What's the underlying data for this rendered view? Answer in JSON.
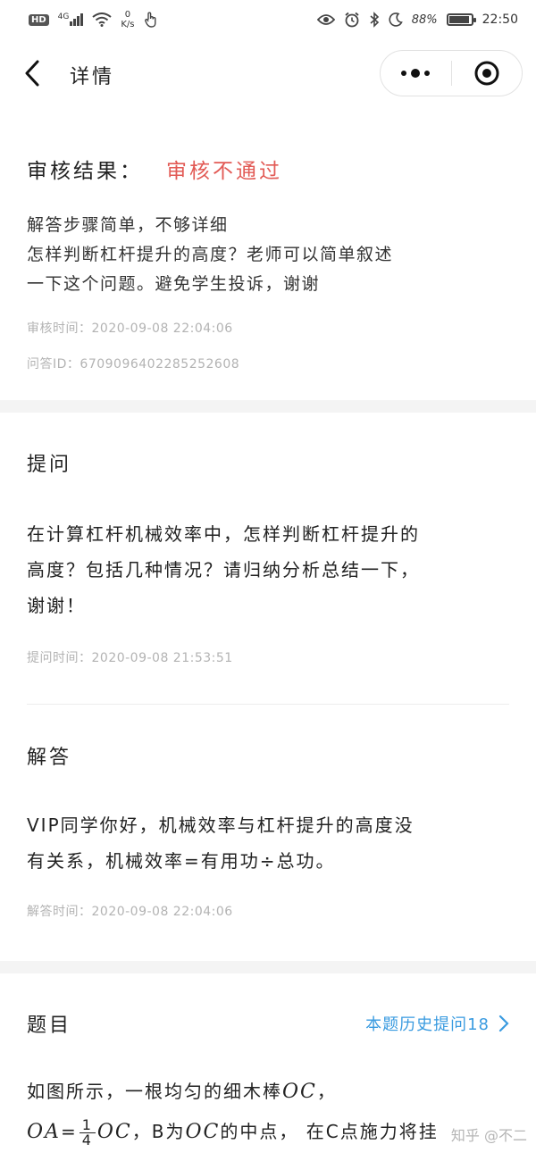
{
  "status_bar": {
    "hd": "HD",
    "network": "4G",
    "speed_value": "0",
    "speed_unit": "K/s",
    "battery": "88%",
    "time": "22:50"
  },
  "nav": {
    "title": "详情"
  },
  "review": {
    "label": "审核结果：",
    "value": "审核不通过",
    "reason_line1": "解答步骤简单，不够详细",
    "reason_line2": "怎样判断杠杆提升的高度？老师可以简单叙述",
    "reason_line3": "一下这个问题。避免学生投诉，谢谢",
    "review_time": "审核时间：2020-09-08 22:04:06",
    "qa_id": "问答ID：6709096402285252608"
  },
  "question": {
    "title": "提问",
    "line1": "在计算杠杆机械效率中，怎样判断杠杆提升的",
    "line2": "高度？包括几种情况？请归纳分析总结一下，",
    "line3": "谢谢！",
    "time": "提问时间：2020-09-08 21:53:51"
  },
  "answer": {
    "title": "解答",
    "line1": "VIP同学你好，机械效率与杠杆提升的高度没",
    "line2": "有关系，机械效率=有用功÷总功。",
    "time": "解答时间：2020-09-08 22:04:06"
  },
  "problem": {
    "title": "题目",
    "history_link": "本题历史提问18",
    "line1_text": "如图所示，一根均匀的细木棒",
    "line1_math": "OC",
    "line1_end": "，",
    "line2_math_a": "OA",
    "line2_eq": "=",
    "frac_num": "1",
    "frac_den": "4",
    "line2_math_b": "OC",
    "line2_text_a": "，B为",
    "line2_math_c": "OC",
    "line2_text_b": "的中点，  在C点施力将挂"
  },
  "watermark": "知乎 @不二"
}
